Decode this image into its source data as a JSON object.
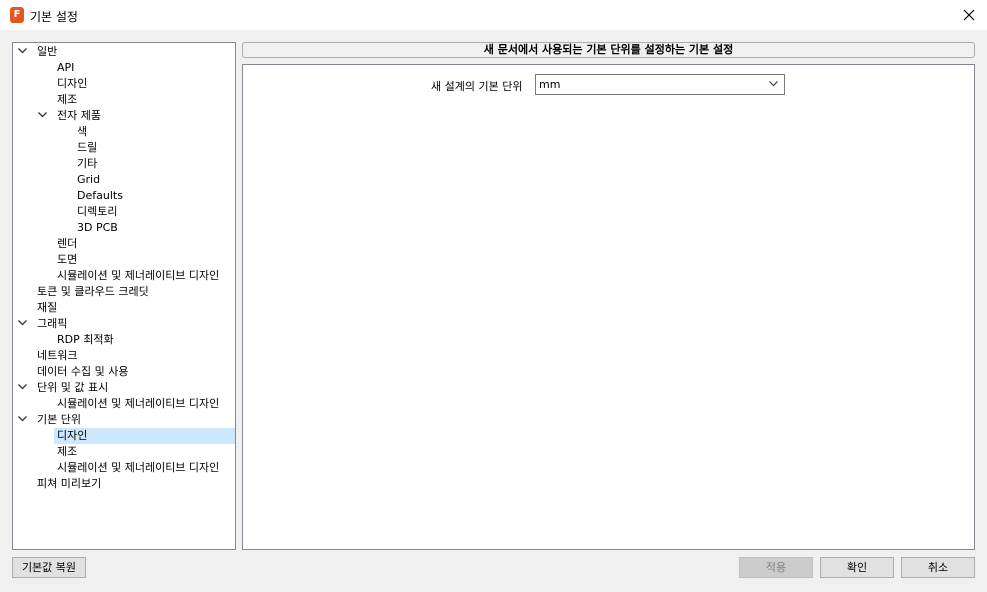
{
  "window": {
    "title": "기본 설정",
    "app_icon_letter": "F"
  },
  "tree": {
    "items": [
      {
        "label": "일반",
        "level": 0,
        "expanded": true
      },
      {
        "label": "API",
        "level": 1
      },
      {
        "label": "디자인",
        "level": 1
      },
      {
        "label": "제조",
        "level": 1
      },
      {
        "label": "전자 제품",
        "level": 1,
        "expanded": true
      },
      {
        "label": "색",
        "level": 2
      },
      {
        "label": "드릴",
        "level": 2
      },
      {
        "label": "기타",
        "level": 2
      },
      {
        "label": "Grid",
        "level": 2
      },
      {
        "label": "Defaults",
        "level": 2
      },
      {
        "label": "디렉토리",
        "level": 2
      },
      {
        "label": "3D PCB",
        "level": 2
      },
      {
        "label": "렌더",
        "level": 1
      },
      {
        "label": "도면",
        "level": 1
      },
      {
        "label": "시뮬레이션 및 제너레이티브 디자인",
        "level": 1
      },
      {
        "label": "토큰 및 클라우드 크레딧",
        "level": 0
      },
      {
        "label": "재질",
        "level": 0
      },
      {
        "label": "그래픽",
        "level": 0,
        "expanded": true
      },
      {
        "label": "RDP 최적화",
        "level": 1
      },
      {
        "label": "네트워크",
        "level": 0
      },
      {
        "label": "데이터 수집 및 사용",
        "level": 0
      },
      {
        "label": "단위 및 값 표시",
        "level": 0,
        "expanded": true
      },
      {
        "label": "시뮬레이션 및 제너레이티브 디자인",
        "level": 1
      },
      {
        "label": "기본 단위",
        "level": 0,
        "expanded": true
      },
      {
        "label": "디자인",
        "level": 1,
        "selected": true
      },
      {
        "label": "제조",
        "level": 1
      },
      {
        "label": "시뮬레이션 및 제너레이티브 디자인",
        "level": 1
      },
      {
        "label": "피쳐 미리보기",
        "level": 0
      }
    ]
  },
  "panel": {
    "header": "새 문서에서 사용되는 기본 단위를 설정하는 기본 설정",
    "field_label": "새 설계의 기본 단위",
    "unit_value": "mm"
  },
  "buttons": {
    "restore": "기본값 복원",
    "apply": "적용",
    "ok": "확인",
    "cancel": "취소"
  },
  "colors": {
    "selection": "#cce8ff",
    "app_icon": "#e8561f"
  }
}
